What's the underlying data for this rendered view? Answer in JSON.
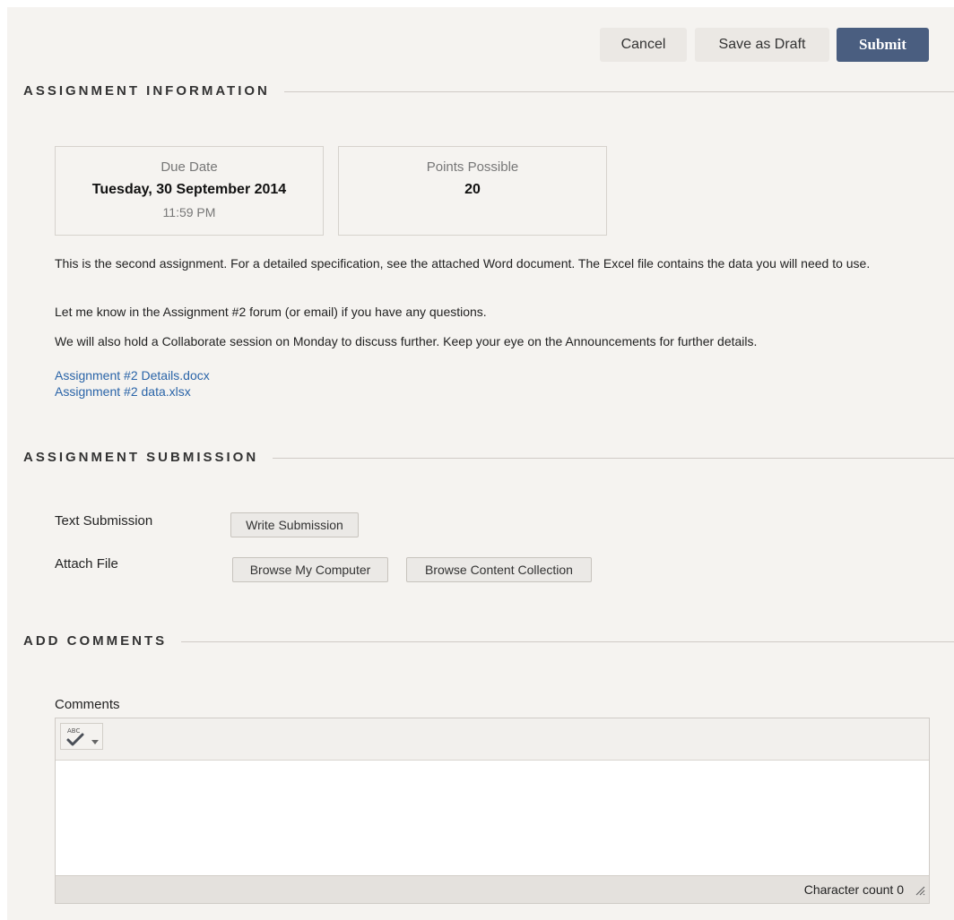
{
  "actions": {
    "cancel": "Cancel",
    "save_draft": "Save as Draft",
    "submit": "Submit"
  },
  "assignment_info": {
    "title": "ASSIGNMENT INFORMATION",
    "due_date": {
      "label": "Due Date",
      "date": "Tuesday, 30 September 2014",
      "time": "11:59 PM"
    },
    "points": {
      "label": "Points Possible",
      "value": "20"
    },
    "description": [
      "This is the second assignment.  For a detailed specification, see the attached Word document.  The Excel file contains the data you will need to use.",
      "Let me know in the Assignment #2 forum (or email) if you have any questions.",
      "We will also hold a Collaborate session on Monday to discuss further.  Keep your eye on the Announcements for further details."
    ],
    "attachments": [
      "Assignment #2 Details.docx",
      "Assignment #2 data.xlsx"
    ]
  },
  "assignment_submission": {
    "title": "ASSIGNMENT SUBMISSION",
    "text_submission_label": "Text Submission",
    "write_submission": "Write Submission",
    "attach_file_label": "Attach File",
    "browse_computer": "Browse My Computer",
    "browse_collection": "Browse Content Collection"
  },
  "comments": {
    "title": "ADD COMMENTS",
    "label": "Comments",
    "spellcheck_text": "ABC",
    "character_count": "Character count 0"
  },
  "icons": {
    "spellcheck": "spellcheck-icon",
    "dropdown": "chevron-down-icon",
    "resize": "resize-handle-icon"
  }
}
